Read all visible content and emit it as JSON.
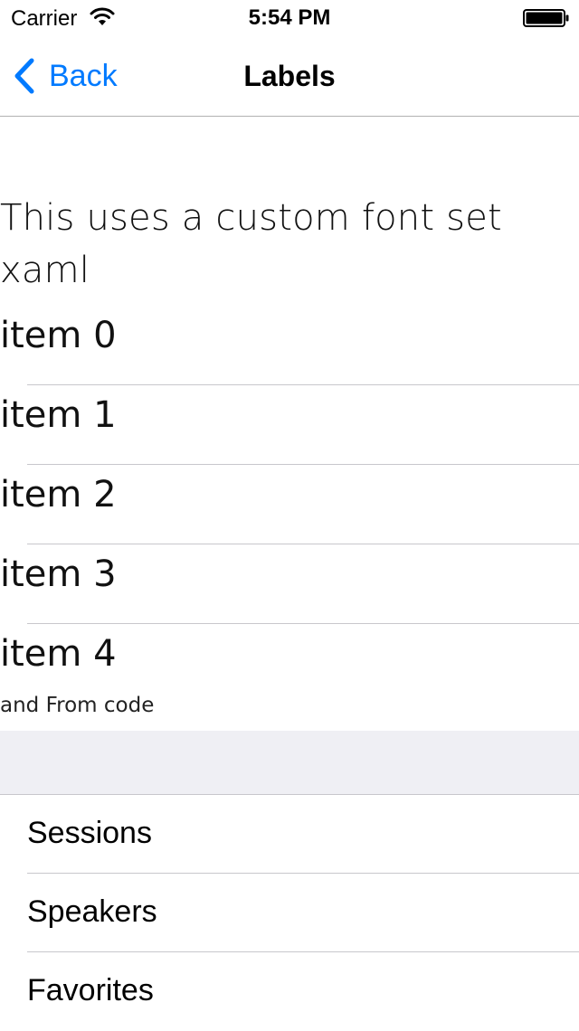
{
  "status_bar": {
    "carrier": "Carrier",
    "time": "5:54 PM",
    "icons": [
      "wifi-icon",
      "battery-icon"
    ]
  },
  "nav_bar": {
    "back_label": "Back",
    "title": "Labels",
    "accent_color": "#007aff"
  },
  "content": {
    "custom_font_text": "This uses a custom font set xaml",
    "items": [
      {
        "label": "item 0"
      },
      {
        "label": "item 1"
      },
      {
        "label": "item 2"
      },
      {
        "label": "item 3"
      },
      {
        "label": "item 4"
      }
    ],
    "from_code_text": "and From code"
  },
  "menu": {
    "items": [
      {
        "label": "Sessions"
      },
      {
        "label": "Speakers"
      },
      {
        "label": "Favorites"
      }
    ]
  },
  "colors": {
    "separator": "#c8c7cc",
    "section_background": "#efeff4",
    "accent": "#007aff"
  }
}
